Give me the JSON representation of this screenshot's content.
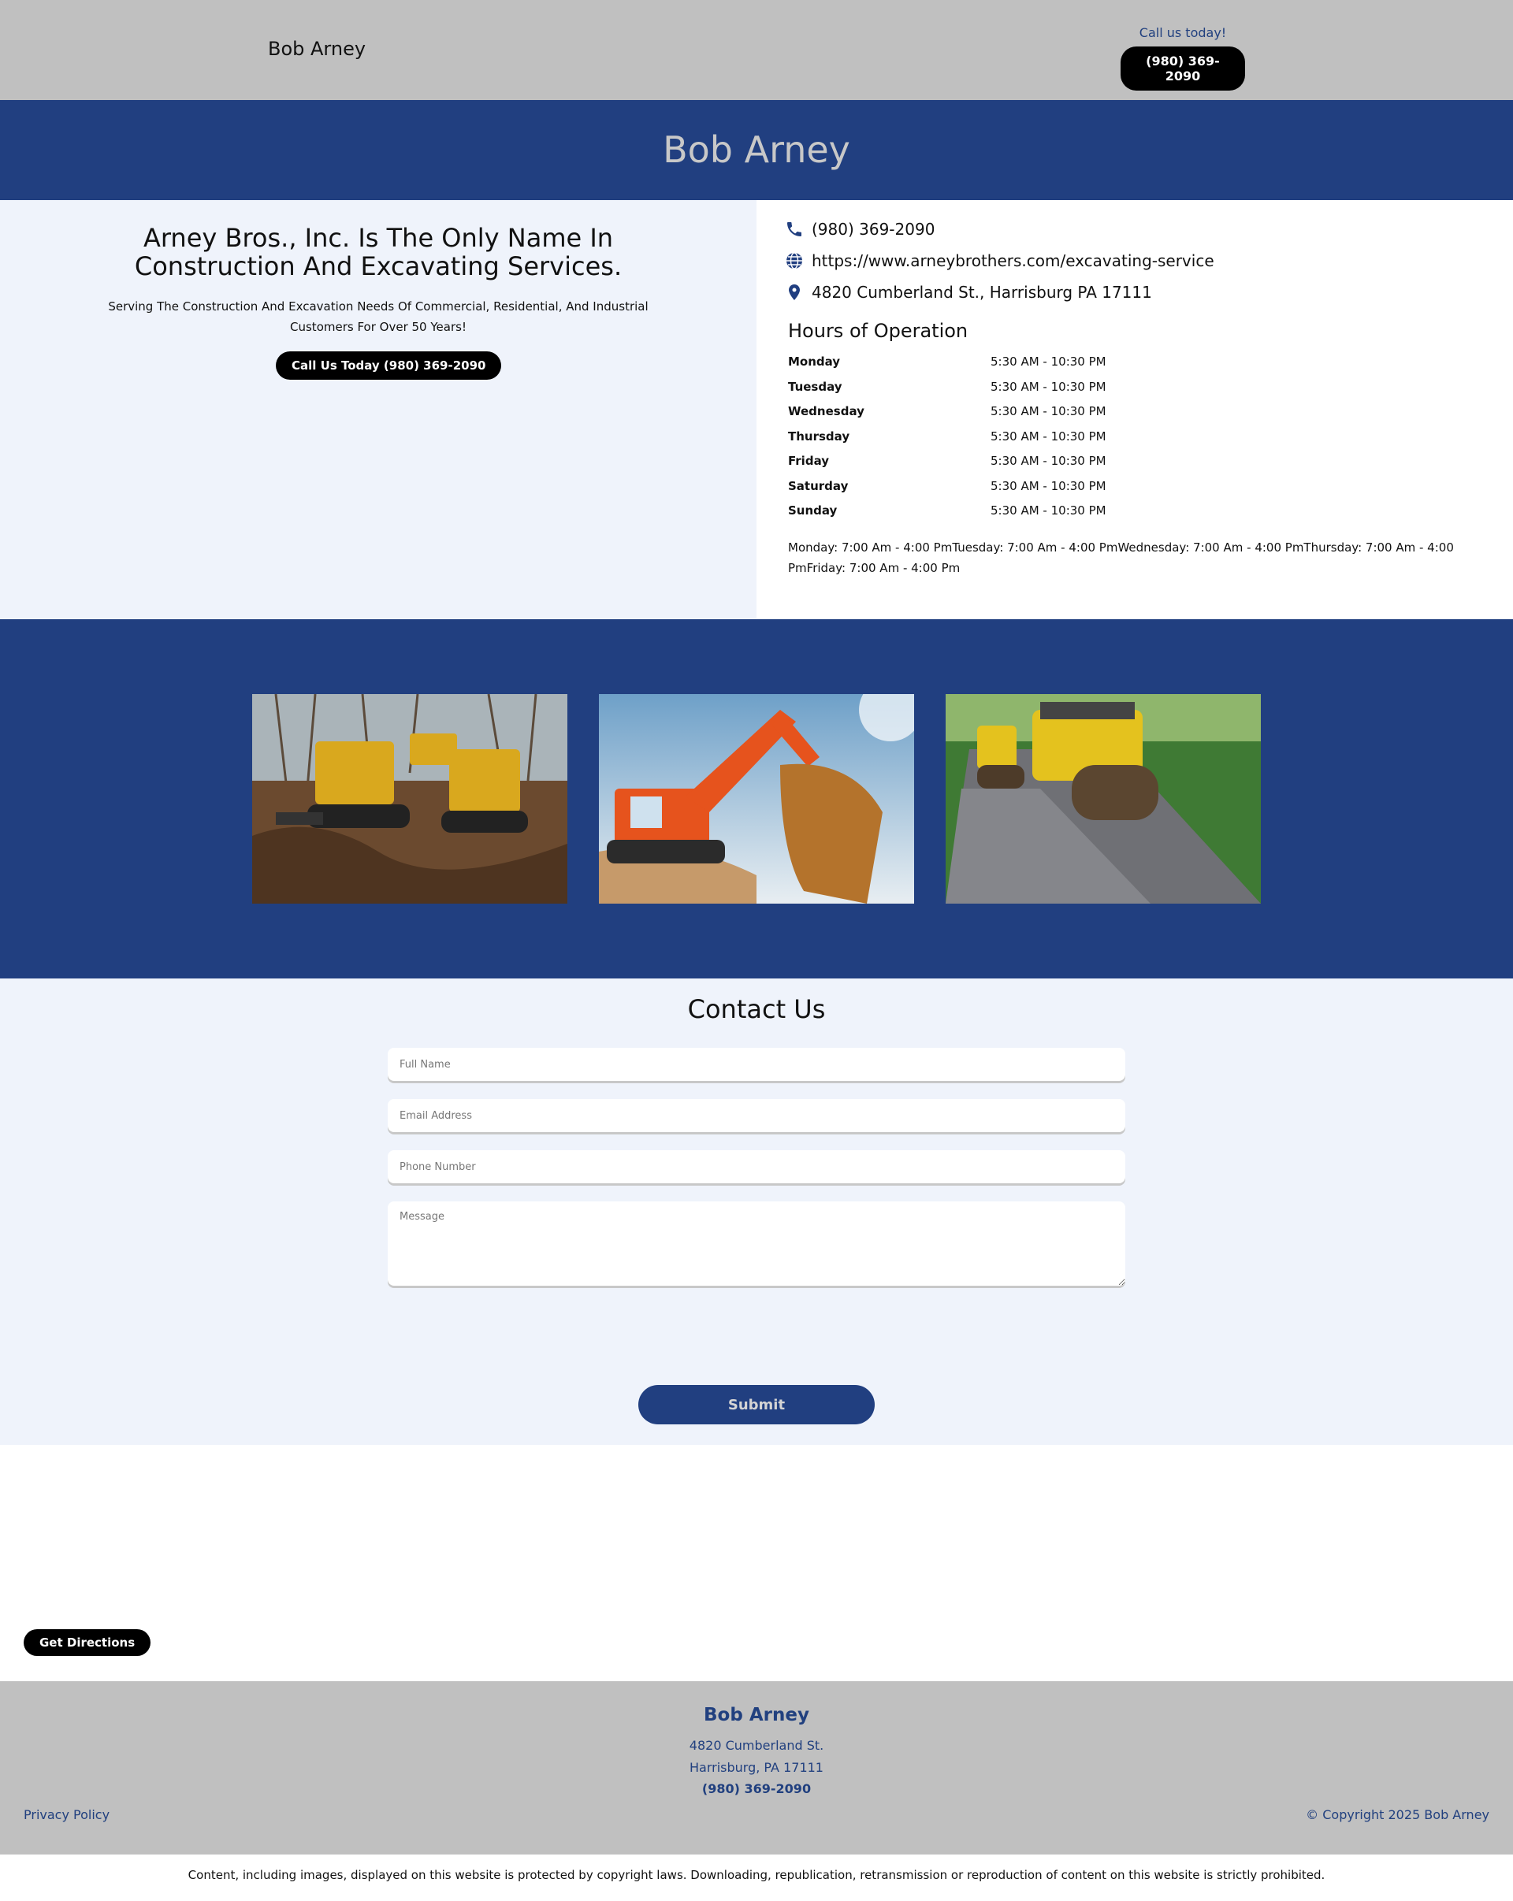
{
  "header": {
    "brand": "Bob Arney",
    "call_label": "Call us today!",
    "phone": "(980) 369-2090"
  },
  "banner": {
    "title": "Bob Arney"
  },
  "intro": {
    "headline": "Arney Bros., Inc. Is The Only Name In Construction And Excavating Services.",
    "subtext": "Serving The Construction And Excavation Needs Of Commercial, Residential, And Industrial Customers For Over 50 Years!",
    "cta_label": "Call Us Today (980) 369-2090"
  },
  "contact_info": {
    "phone": "(980) 369-2090",
    "website": "https://www.arneybrothers.com/excavating-service",
    "address": "4820 Cumberland St., Harrisburg PA 17111",
    "icons": [
      "phone-icon",
      "globe-icon",
      "map-pin-icon"
    ]
  },
  "hours": {
    "title": "Hours of Operation",
    "rows": [
      {
        "day": "Monday",
        "time": "5:30 AM - 10:30 PM"
      },
      {
        "day": "Tuesday",
        "time": "5:30 AM - 10:30 PM"
      },
      {
        "day": "Wednesday",
        "time": "5:30 AM - 10:30 PM"
      },
      {
        "day": "Thursday",
        "time": "5:30 AM - 10:30 PM"
      },
      {
        "day": "Friday",
        "time": "5:30 AM - 10:30 PM"
      },
      {
        "day": "Saturday",
        "time": "5:30 AM - 10:30 PM"
      },
      {
        "day": "Sunday",
        "time": "5:30 AM - 10:30 PM"
      }
    ],
    "note": "Monday: 7:00 Am - 4:00 PmTuesday: 7:00 Am - 4:00 PmWednesday: 7:00 Am - 4:00 PmThursday: 7:00 Am - 4:00 PmFriday: 7:00 Am - 4:00 Pm"
  },
  "contact_form": {
    "title": "Contact Us",
    "full_name_placeholder": "Full Name",
    "email_placeholder": "Email Address",
    "phone_placeholder": "Phone Number",
    "message_placeholder": "Message",
    "submit_label": "Submit"
  },
  "map": {
    "directions_label": "Get Directions"
  },
  "footer": {
    "name": "Bob Arney",
    "street": "4820 Cumberland St.",
    "city": "Harrisburg, PA 17111",
    "phone": "(980) 369-2090",
    "privacy_label": "Privacy Policy",
    "copyright": "© Copyright 2025 Bob Arney"
  },
  "disclaimer": "Content, including images, displayed on this website is protected by copyright laws. Downloading, republication, retransmission or reproduction of content on this website is strictly prohibited.",
  "colors": {
    "brand_blue": "#213f80",
    "header_gray": "#c0c0c0",
    "light_bg": "#eff3fb"
  }
}
